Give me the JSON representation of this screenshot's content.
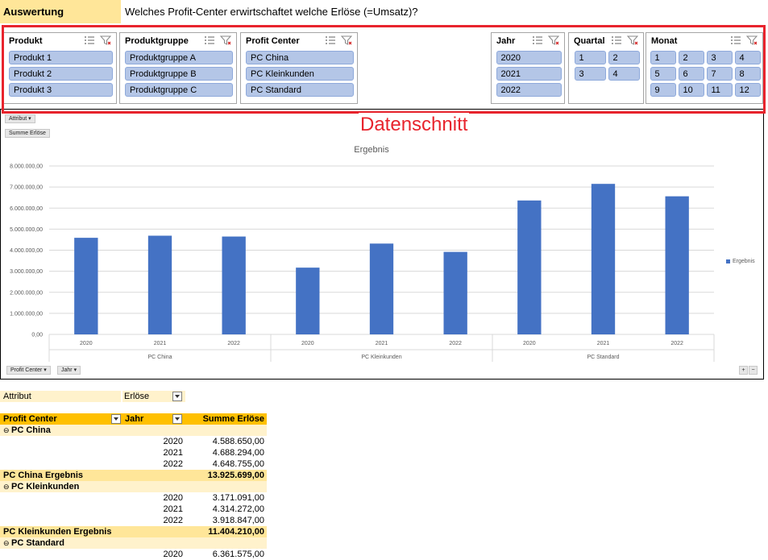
{
  "header": {
    "label": "Auswertung",
    "question": "Welches Profit-Center erwirtschaftet welche Erlöse (=Umsatz)?"
  },
  "annotation": {
    "caption": "Datenschnitt",
    "color": "#e8242d"
  },
  "slicers": [
    {
      "id": "produkt",
      "title": "Produkt",
      "items": [
        "Produkt 1",
        "Produkt 2",
        "Produkt 3"
      ]
    },
    {
      "id": "produktgruppe",
      "title": "Produktgruppe",
      "items": [
        "Produktgruppe A",
        "Produktgruppe B",
        "Produktgruppe C"
      ]
    },
    {
      "id": "profit-center",
      "title": "Profit  Center",
      "items": [
        "PC China",
        "PC Kleinkunden",
        "PC Standard"
      ]
    },
    {
      "id": "jahr",
      "title": "Jahr",
      "items": [
        "2020",
        "2021",
        "2022"
      ]
    },
    {
      "id": "quartal",
      "title": "Quartal",
      "items": [
        "1",
        "2",
        "3",
        "4"
      ]
    },
    {
      "id": "monat",
      "title": "Monat",
      "items": [
        "1",
        "2",
        "3",
        "4",
        "5",
        "6",
        "7",
        "8",
        "9",
        "10",
        "11",
        "12"
      ]
    }
  ],
  "pivot_chart": {
    "filter_button": "Attribut",
    "value_button": "Summe Erlöse",
    "axis_buttons": [
      "Profit  Center",
      "Jahr"
    ],
    "zoom_buttons": [
      "+",
      "−"
    ]
  },
  "chart_data": {
    "type": "bar",
    "title": "Ergebnis",
    "ylim": [
      0,
      8000000
    ],
    "yticks": [
      "0,00",
      "1.000.000,00",
      "2.000.000,00",
      "3.000.000,00",
      "4.000.000,00",
      "5.000.000,00",
      "6.000.000,00",
      "7.000.000,00",
      "8.000.000,00"
    ],
    "groups": [
      "PC China",
      "PC Kleinkunden",
      "PC Standard"
    ],
    "categories": [
      "2020",
      "2021",
      "2022",
      "2020",
      "2021",
      "2022",
      "2020",
      "2021",
      "2022"
    ],
    "series": [
      {
        "name": "Ergebnis",
        "color": "#4472c4",
        "values": [
          4588650,
          4688294,
          4648755,
          3171091,
          4314272,
          3918847,
          6361575,
          7150000,
          6560000
        ]
      }
    ],
    "legend": "right",
    "grid": true
  },
  "pivot_table": {
    "filter_label": "Attribut",
    "filter_value": "Erlöse",
    "headers": [
      "Profit  Center",
      "Jahr",
      "Summe Erlöse"
    ],
    "rows": [
      {
        "kind": "group",
        "label": "PC China"
      },
      {
        "kind": "item",
        "year": "2020",
        "value": "4.588.650,00"
      },
      {
        "kind": "item",
        "year": "2021",
        "value": "4.688.294,00"
      },
      {
        "kind": "item",
        "year": "2022",
        "value": "4.648.755,00"
      },
      {
        "kind": "subtotal",
        "label": "PC China Ergebnis",
        "value": "13.925.699,00"
      },
      {
        "kind": "group",
        "label": "PC Kleinkunden"
      },
      {
        "kind": "item",
        "year": "2020",
        "value": "3.171.091,00"
      },
      {
        "kind": "item",
        "year": "2021",
        "value": "4.314.272,00"
      },
      {
        "kind": "item",
        "year": "2022",
        "value": "3.918.847,00"
      },
      {
        "kind": "subtotal",
        "label": "PC Kleinkunden Ergebnis",
        "value": "11.404.210,00"
      },
      {
        "kind": "group",
        "label": "PC Standard"
      },
      {
        "kind": "item",
        "year": "2020",
        "value": "6.361.575,00"
      }
    ]
  }
}
